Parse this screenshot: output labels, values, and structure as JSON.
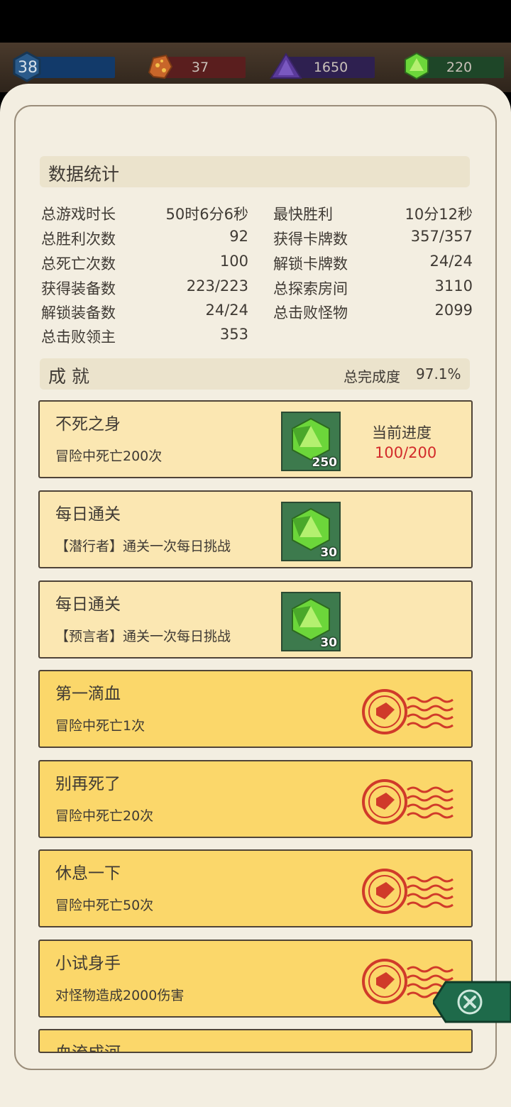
{
  "resources": {
    "level": "38",
    "ore": "37",
    "crystal": "1650",
    "gems": "220"
  },
  "stats": {
    "title": "数据统计",
    "left": [
      {
        "label": "总游戏时长",
        "value": "50时6分6秒"
      },
      {
        "label": "总胜利次数",
        "value": "92"
      },
      {
        "label": "总死亡次数",
        "value": "100"
      },
      {
        "label": "获得装备数",
        "value": "223/223"
      },
      {
        "label": "解锁装备数",
        "value": "24/24"
      },
      {
        "label": "总击败领主",
        "value": "353"
      }
    ],
    "right": [
      {
        "label": "最快胜利",
        "value": "10分12秒"
      },
      {
        "label": "获得卡牌数",
        "value": "357/357"
      },
      {
        "label": "解锁卡牌数",
        "value": "24/24"
      },
      {
        "label": "总探索房间",
        "value": "3110"
      },
      {
        "label": "总击败怪物",
        "value": "2099"
      }
    ]
  },
  "achievements": {
    "title": "成 就",
    "completion_label": "总完成度",
    "completion_value": "97.1%",
    "items": [
      {
        "title": "不死之身",
        "desc": "冒险中死亡200次",
        "reward": "250",
        "progress_label": "当前进度",
        "progress": "100/200"
      },
      {
        "title": "每日通关",
        "desc": "【潜行者】通关一次每日挑战",
        "reward": "30"
      },
      {
        "title": "每日通关",
        "desc": "【预言者】通关一次每日挑战",
        "reward": "30"
      },
      {
        "title": "第一滴血",
        "desc": "冒险中死亡1次"
      },
      {
        "title": "别再死了",
        "desc": "冒险中死亡20次"
      },
      {
        "title": "休息一下",
        "desc": "冒险中死亡50次"
      },
      {
        "title": "小试身手",
        "desc": "对怪物造成2000伤害"
      },
      {
        "title": "血流成河",
        "desc": ""
      }
    ]
  },
  "colors": {
    "pending_card": "#fbe7b2",
    "completed_card": "#fbd76a",
    "progress_text": "#d22a2a",
    "stamp": "#d03a2a",
    "gem": "#6cd63a"
  }
}
